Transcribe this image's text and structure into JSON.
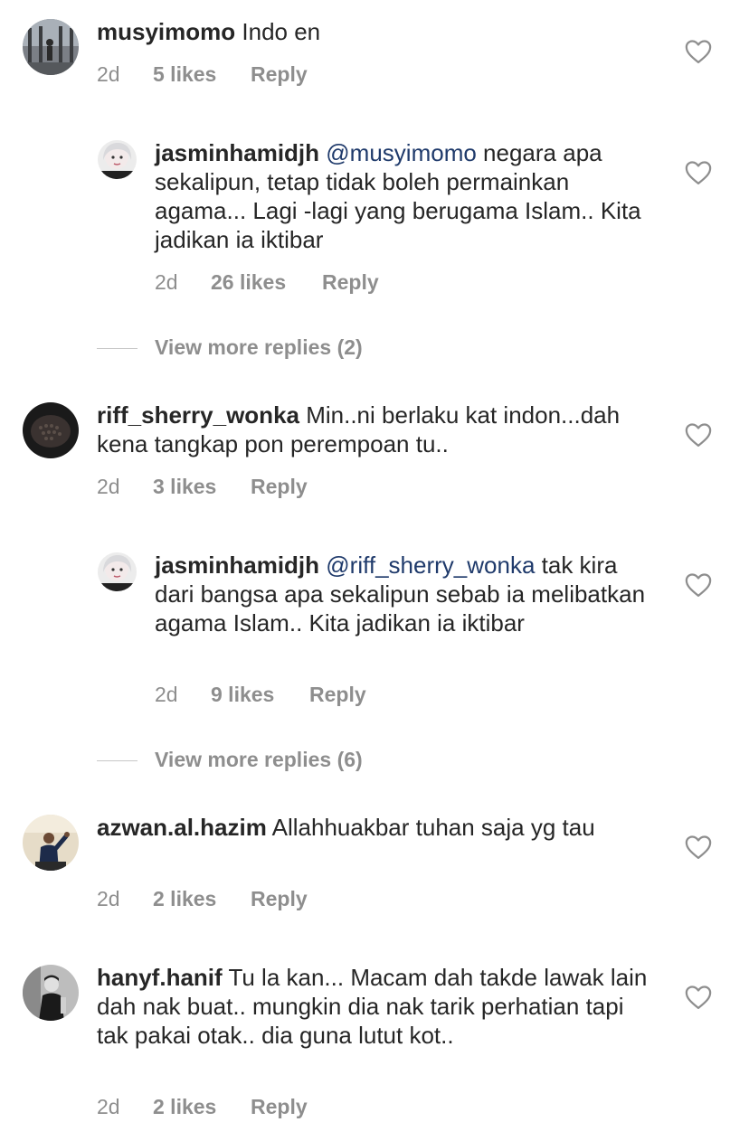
{
  "comments": [
    {
      "username": "musyimomo",
      "mention": "",
      "text": "Indo en",
      "time": "2d",
      "likes": "5 likes",
      "reply": "Reply",
      "avatar": "avatar-street"
    },
    {
      "username": "jasminhamidjh",
      "mention": "@musyimomo",
      "text": "negara apa sekalipun, tetap tidak boleh permainkan agama... Lagi -lagi yang berugama Islam.. Kita jadikan ia iktibar",
      "time": "2d",
      "likes": "26 likes",
      "reply": "Reply",
      "avatar": "avatar-woman"
    },
    {
      "username": "riff_sherry_wonka",
      "mention": "",
      "text": "Min..ni berlaku kat indon...dah kena tangkap pon perempoan tu..",
      "time": "2d",
      "likes": "3 likes",
      "reply": "Reply",
      "avatar": "avatar-dark"
    },
    {
      "username": "jasminhamidjh",
      "mention": "@riff_sherry_wonka",
      "text": "tak kira dari bangsa apa sekalipun sebab ia melibatkan agama Islam.. Kita jadikan ia iktibar",
      "time": "2d",
      "likes": "9 likes",
      "reply": "Reply",
      "avatar": "avatar-woman"
    },
    {
      "username": "azwan.al.hazim",
      "mention": "",
      "text": "Allahhuakbar tuhan saja yg tau",
      "time": "2d",
      "likes": "2 likes",
      "reply": "Reply",
      "avatar": "avatar-man-pose"
    },
    {
      "username": "hanyf.hanif",
      "mention": "",
      "text": "Tu la kan... Macam dah takde lawak lain dah nak buat.. mungkin dia nak tarik perhatian tapi tak pakai otak.. dia guna lutut kot..",
      "time": "2d",
      "likes": "2 likes",
      "reply": "Reply",
      "avatar": "avatar-man-bw"
    }
  ],
  "view_more": [
    {
      "label": "View more replies (2)"
    },
    {
      "label": "View more replies (6)"
    }
  ],
  "icons": {
    "like": "heart-outline-icon"
  },
  "colors": {
    "text": "#262626",
    "meta": "#8e8e8e",
    "mention": "#1f3a6b",
    "divider": "#c7c7c7"
  }
}
